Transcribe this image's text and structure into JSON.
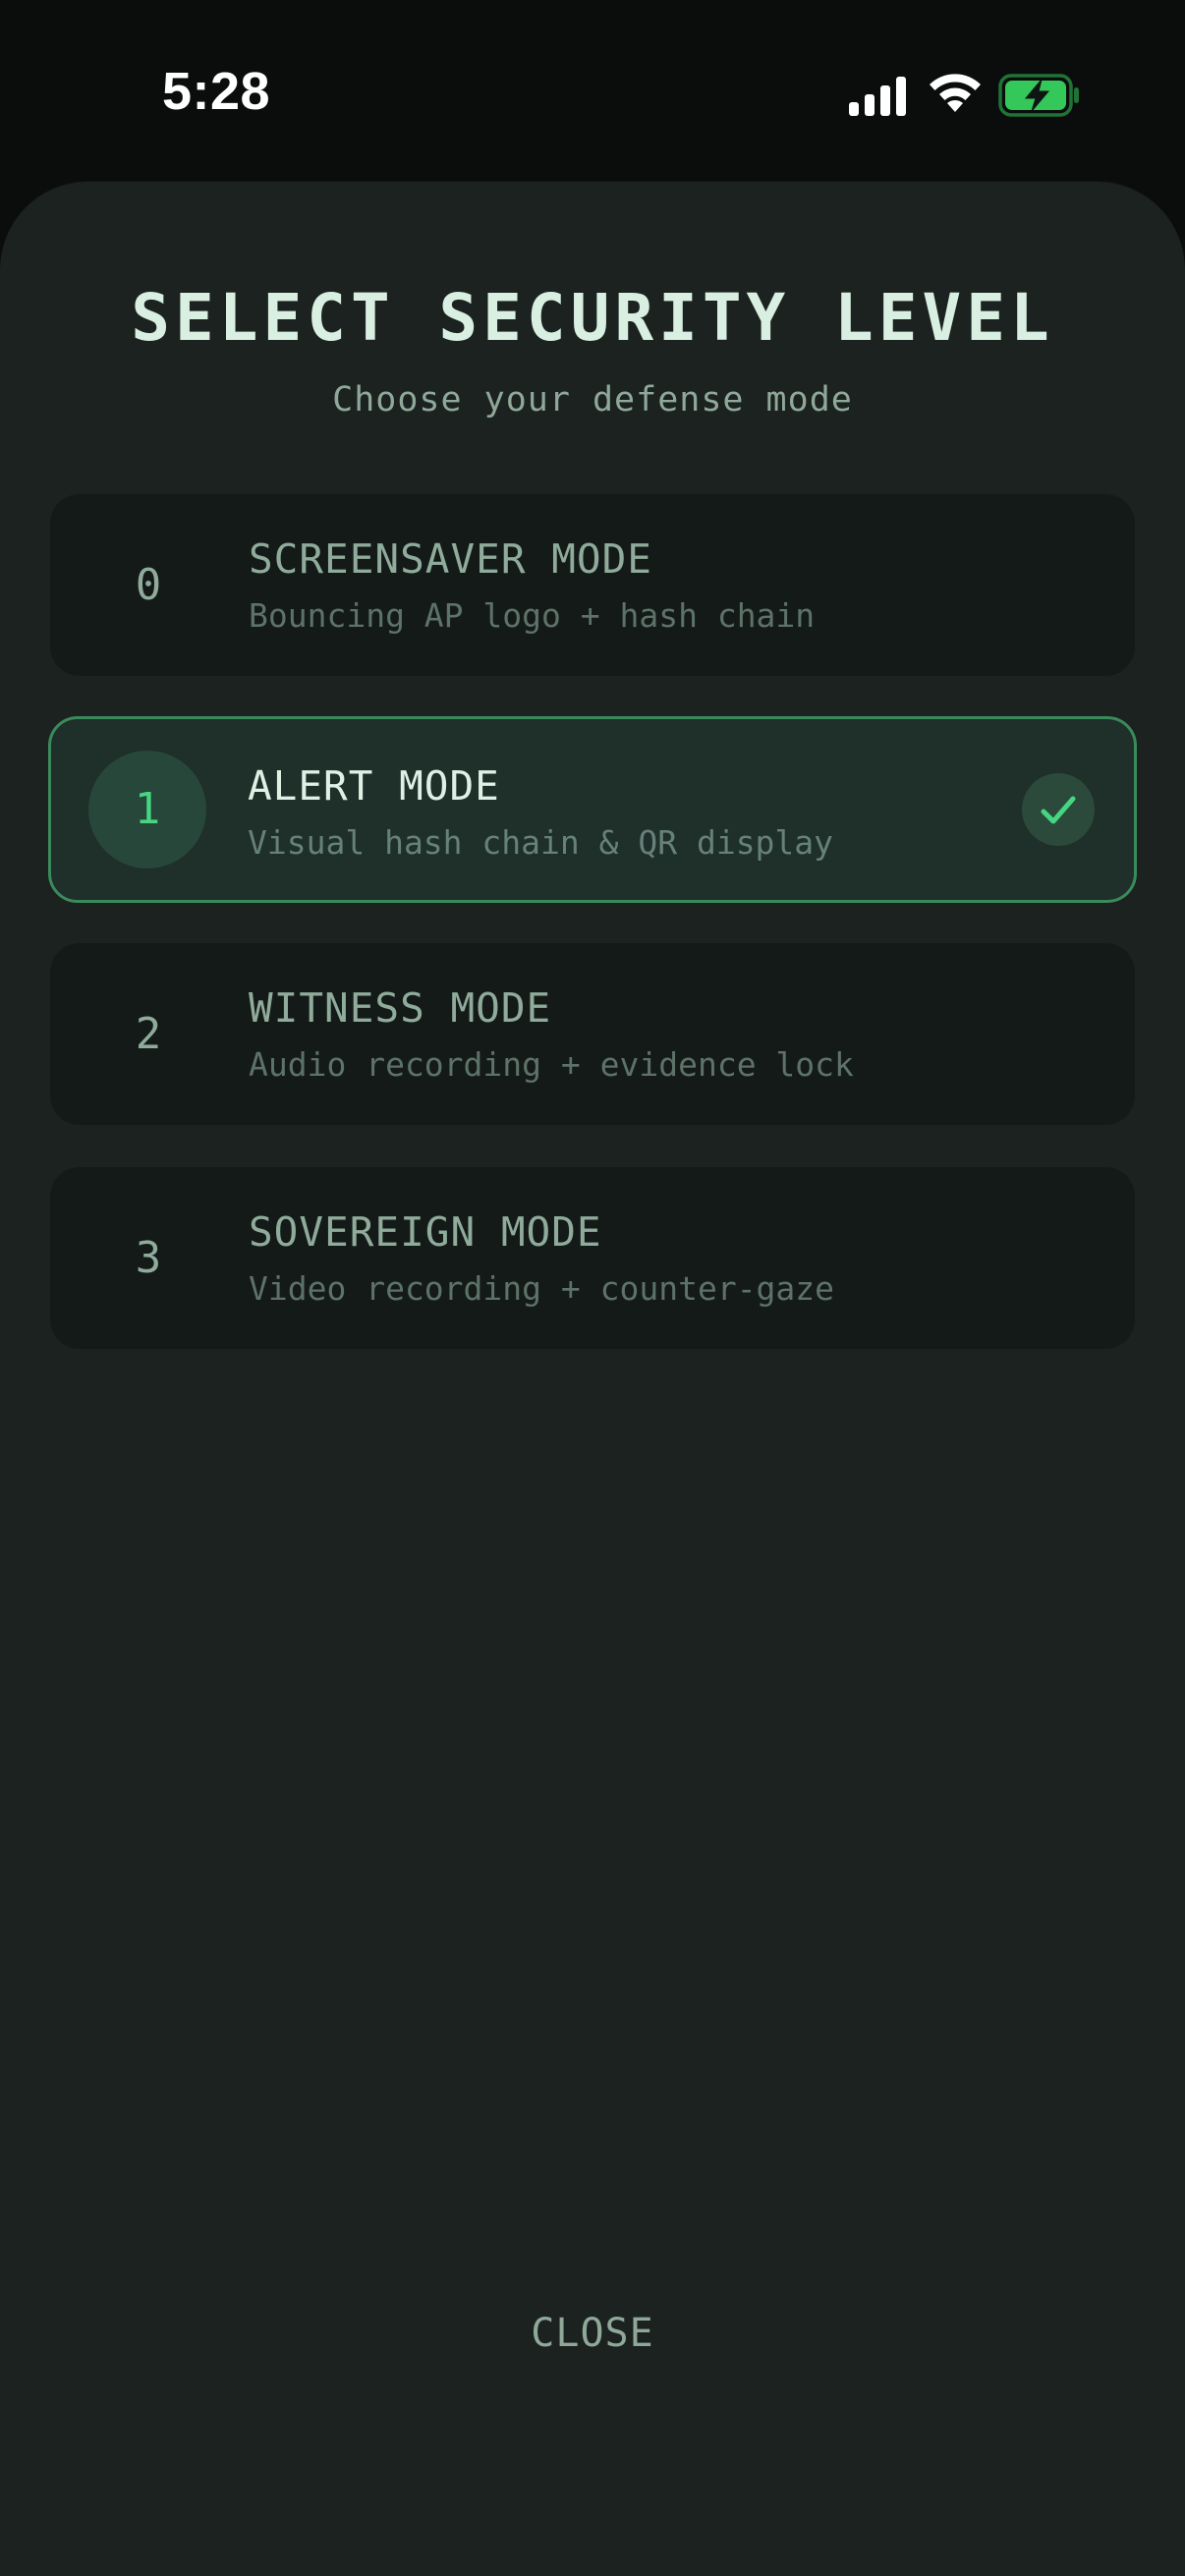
{
  "status_bar": {
    "time": "5:28",
    "icons": [
      "signal-icon",
      "wifi-icon",
      "battery-charging-icon"
    ],
    "battery_color": "#34c759"
  },
  "sheet": {
    "title": "SELECT SECURITY LEVEL",
    "subtitle": "Choose your defense mode",
    "modes": [
      {
        "level": "0",
        "name": "SCREENSAVER MODE",
        "description": "Bouncing AP logo + hash chain",
        "selected": false
      },
      {
        "level": "1",
        "name": "ALERT MODE",
        "description": "Visual hash chain & QR display",
        "selected": true
      },
      {
        "level": "2",
        "name": "WITNESS MODE",
        "description": "Audio recording + evidence lock",
        "selected": false
      },
      {
        "level": "3",
        "name": "SOVEREIGN MODE",
        "description": "Video recording + counter-gaze",
        "selected": false
      }
    ],
    "selected_icon": "checkmark-icon",
    "close_label": "CLOSE"
  },
  "colors": {
    "background": "#0a0d0c",
    "sheet": "#1b2220",
    "card": "#141a18",
    "selected_card": "#1f2f29",
    "selected_border": "#3a8a5c",
    "accent_green": "#46d682",
    "text_primary": "#d9efe2",
    "text_muted": "#8fa89a"
  }
}
